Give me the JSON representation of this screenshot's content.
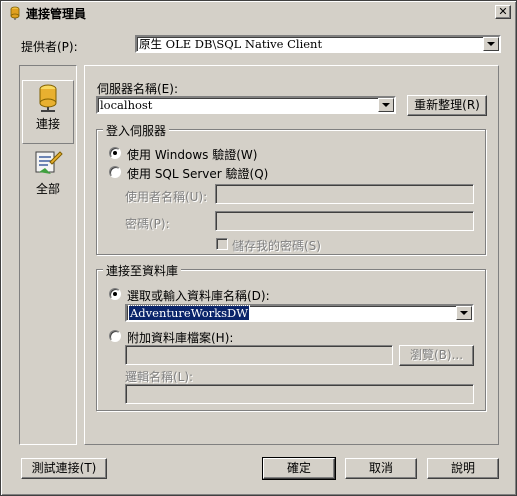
{
  "window": {
    "title": "連接管理員",
    "close_glyph": "✕"
  },
  "provider": {
    "label": "提供者(P):",
    "value": "原生 OLE DB\\SQL Native Client"
  },
  "sidebar": {
    "items": [
      {
        "label": "連接",
        "icon": "database-cylinder-icon",
        "selected": true
      },
      {
        "label": "全部",
        "icon": "properties-list-icon",
        "selected": false
      }
    ]
  },
  "server": {
    "label": "伺服器名稱(E):",
    "value": "localhost",
    "refresh_label": "重新整理(R)"
  },
  "login": {
    "legend": "登入伺服器",
    "windows_auth_label": "使用 Windows 驗證(W)",
    "sql_auth_label": "使用 SQL Server 驗證(Q)",
    "username_label": "使用者名稱(U):",
    "username_value": "",
    "password_label": "密碼(P):",
    "password_value": "",
    "save_password_label": "儲存我的密碼(S)",
    "selected": "windows"
  },
  "database": {
    "legend": "連接至資料庫",
    "select_db_label": "選取或輸入資料庫名稱(D):",
    "select_db_value": "AdventureWorksDW",
    "attach_label": "附加資料庫檔案(H):",
    "attach_value": "",
    "browse_label": "瀏覽(B)...",
    "logical_name_label": "邏輯名稱(L):",
    "logical_name_value": "",
    "selected": "select"
  },
  "footer": {
    "test_label": "測試連接(T)",
    "ok_label": "確定",
    "cancel_label": "取消",
    "help_label": "說明"
  },
  "colors": {
    "face": "#d4d0c8",
    "selection": "#0a246a"
  }
}
